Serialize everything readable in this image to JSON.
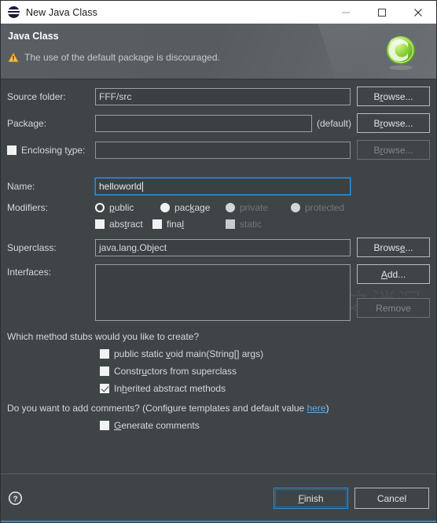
{
  "window": {
    "title": "New Java Class",
    "icon": "eclipse-sphere-icon",
    "controls": {
      "minimize": "minimize-icon",
      "maximize": "maximize-icon",
      "close": "close-icon"
    }
  },
  "header": {
    "title": "Java Class",
    "warning_icon": "warning-triangle-icon",
    "message": "The use of the default package is discouraged.",
    "logo": "java-class-green-c-logo"
  },
  "watermark": "意之消沉",
  "form": {
    "source_folder": {
      "label": "Source folder:",
      "value": "FFF/src",
      "browse": "Browse..."
    },
    "package": {
      "label": "Package:",
      "value": "",
      "suffix": "(default)",
      "browse": "Browse..."
    },
    "enclosing_type": {
      "label": "Enclosing type:",
      "checked": false,
      "value": "",
      "browse": "Browse...",
      "disabled": true
    },
    "name": {
      "label": "Name:",
      "value": "helloworld",
      "focused": true
    },
    "modifiers": {
      "label": "Modifiers:",
      "access": [
        {
          "label": "public",
          "selected": true,
          "disabled": false
        },
        {
          "label": "package",
          "selected": false,
          "disabled": false
        },
        {
          "label": "private",
          "selected": false,
          "disabled": true
        },
        {
          "label": "protected",
          "selected": false,
          "disabled": true
        }
      ],
      "flags": [
        {
          "label": "abstract",
          "checked": false,
          "disabled": false
        },
        {
          "label": "final",
          "checked": false,
          "disabled": false
        },
        {
          "label": "static",
          "checked": false,
          "disabled": true
        }
      ]
    },
    "superclass": {
      "label": "Superclass:",
      "value": "java.lang.Object",
      "browse": "Browse..."
    },
    "interfaces": {
      "label": "Interfaces:",
      "items": [],
      "add": "Add...",
      "remove": "Remove"
    }
  },
  "stubs": {
    "question": "Which method stubs would you like to create?",
    "options": [
      {
        "label": "public static void main(String[] args)",
        "checked": false
      },
      {
        "label": "Constructors from superclass",
        "checked": false
      },
      {
        "label": "Inherited abstract methods",
        "checked": true
      }
    ]
  },
  "comments": {
    "question_pre": "Do you want to add comments? (Configure templates and default value ",
    "link": "here",
    "question_post": ")",
    "generate": {
      "label": "Generate comments",
      "checked": false
    }
  },
  "footer": {
    "help_icon": "help-question-icon",
    "finish": "Finish",
    "cancel": "Cancel"
  },
  "colors": {
    "dialog_bg": "#3f4447",
    "field_bg": "#3b4043",
    "accent": "#2f8fd8",
    "link": "#62a8e0",
    "logo_green": "#7ac943"
  }
}
